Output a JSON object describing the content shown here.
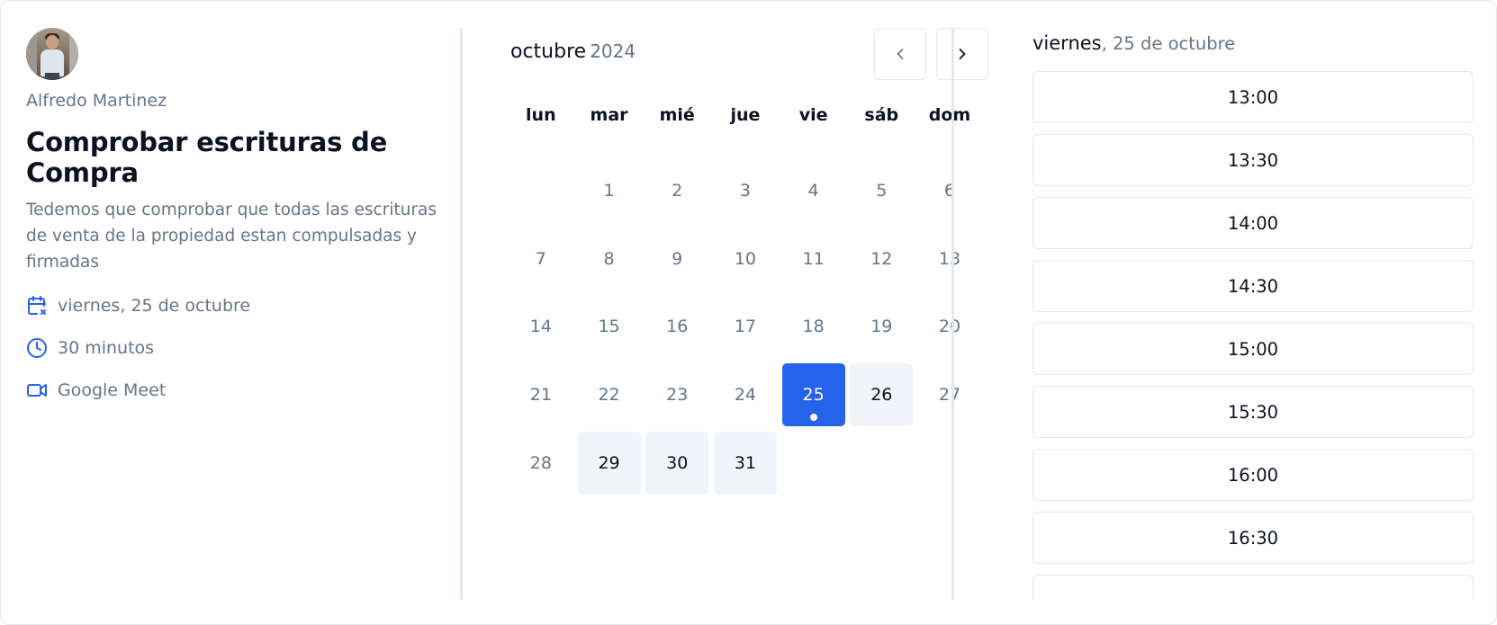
{
  "event": {
    "organizer": "Alfredo Martinez",
    "title": "Comprobar escrituras de Compra",
    "description": "Tedemos que comprobar que todas las escrituras de venta de la propiedad estan compulsadas y firmadas",
    "date_label": "viernes, 25 de octubre",
    "duration_label": "30 minutos",
    "location_label": "Google Meet"
  },
  "calendar": {
    "month": "octubre",
    "year": "2024",
    "weekdays": [
      "lun",
      "mar",
      "mié",
      "jue",
      "vie",
      "sáb",
      "dom"
    ],
    "leading_blanks": 1,
    "days": [
      {
        "label": "1",
        "state": "unavailable"
      },
      {
        "label": "2",
        "state": "unavailable"
      },
      {
        "label": "3",
        "state": "unavailable"
      },
      {
        "label": "4",
        "state": "unavailable"
      },
      {
        "label": "5",
        "state": "unavailable"
      },
      {
        "label": "6",
        "state": "unavailable"
      },
      {
        "label": "7",
        "state": "unavailable"
      },
      {
        "label": "8",
        "state": "unavailable"
      },
      {
        "label": "9",
        "state": "unavailable"
      },
      {
        "label": "10",
        "state": "unavailable"
      },
      {
        "label": "11",
        "state": "unavailable"
      },
      {
        "label": "12",
        "state": "unavailable"
      },
      {
        "label": "13",
        "state": "unavailable"
      },
      {
        "label": "14",
        "state": "unavailable"
      },
      {
        "label": "15",
        "state": "unavailable"
      },
      {
        "label": "16",
        "state": "unavailable"
      },
      {
        "label": "17",
        "state": "unavailable"
      },
      {
        "label": "18",
        "state": "unavailable"
      },
      {
        "label": "19",
        "state": "unavailable"
      },
      {
        "label": "20",
        "state": "unavailable"
      },
      {
        "label": "21",
        "state": "unavailable"
      },
      {
        "label": "22",
        "state": "unavailable"
      },
      {
        "label": "23",
        "state": "unavailable"
      },
      {
        "label": "24",
        "state": "unavailable"
      },
      {
        "label": "25",
        "state": "selected"
      },
      {
        "label": "26",
        "state": "available"
      },
      {
        "label": "27",
        "state": "unavailable"
      },
      {
        "label": "28",
        "state": "unavailable"
      },
      {
        "label": "29",
        "state": "available"
      },
      {
        "label": "30",
        "state": "available"
      },
      {
        "label": "31",
        "state": "available"
      }
    ]
  },
  "slots": {
    "weekday": "viernes",
    "date": ", 25 de octubre",
    "times": [
      "13:00",
      "13:30",
      "14:00",
      "14:30",
      "15:00",
      "15:30",
      "16:00",
      "16:30",
      ""
    ]
  },
  "colors": {
    "accent": "#2563eb",
    "available_bg": "#f1f5f9",
    "muted_text": "#64748b",
    "border": "#e2e8f0"
  }
}
